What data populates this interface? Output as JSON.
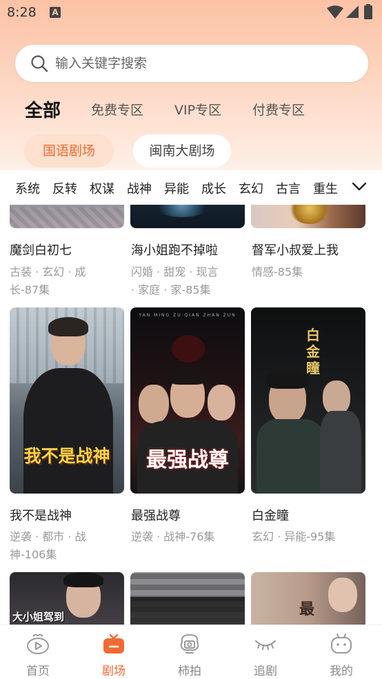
{
  "status_bar": {
    "time": "8:28",
    "notif_letter": "A"
  },
  "search": {
    "placeholder": "输入关键字搜索"
  },
  "top_tabs": [
    {
      "label": "全部",
      "active": true
    },
    {
      "label": "免费专区",
      "active": false
    },
    {
      "label": "VIP专区",
      "active": false
    },
    {
      "label": "付费专区",
      "active": false
    }
  ],
  "sub_tabs": [
    {
      "label": "国语剧场",
      "active": true
    },
    {
      "label": "闽南大剧场",
      "active": false
    }
  ],
  "categories": [
    "系统",
    "反转",
    "权谋",
    "战神",
    "异能",
    "成长",
    "玄幻",
    "古言",
    "重生",
    "复"
  ],
  "dramas": [
    {
      "title": "魔剑白初七",
      "tags_line1": "古装 · 玄幻 · 成",
      "tags_line2": "长-87集"
    },
    {
      "title": "海小姐跑不掉啦",
      "tags_line1": "闪婚 · 甜宠 · 现言",
      "tags_line2": "· 家庭 · 家-85集"
    },
    {
      "title": "督军小叔爱上我",
      "tags_line1": "情感-85集",
      "tags_line2": ""
    },
    {
      "title": "我不是战神",
      "tags_line1": "逆袭 · 都市 · 战",
      "tags_line2": "神-106集",
      "poster_text": "我不是战神"
    },
    {
      "title": "最强战尊",
      "tags_line1": "逆袭 · 战神-76集",
      "tags_line2": "",
      "poster_text": "最强战尊",
      "poster_top": "YAN MING ZU QIAN ZHAN ZUN"
    },
    {
      "title": "白金瞳",
      "tags_line1": "玄幻 · 异能-95集",
      "tags_line2": "",
      "poster_text": "白金瞳"
    },
    {
      "poster_text": "大小姐驾到"
    },
    {
      "poster_text": ""
    },
    {
      "poster_text": "最"
    }
  ],
  "bottom_nav": [
    {
      "label": "首页",
      "icon": "home-play-icon",
      "active": false
    },
    {
      "label": "剧场",
      "icon": "theater-icon",
      "active": true
    },
    {
      "label": "柿拍",
      "icon": "camera-icon",
      "active": false
    },
    {
      "label": "追剧",
      "icon": "eye-icon",
      "active": false
    },
    {
      "label": "我的",
      "icon": "robot-face-icon",
      "active": false
    }
  ],
  "colors": {
    "accent": "#f06a32",
    "pill_active_bg": "#fde0cd",
    "header_gradient": "#fcc2a5"
  }
}
